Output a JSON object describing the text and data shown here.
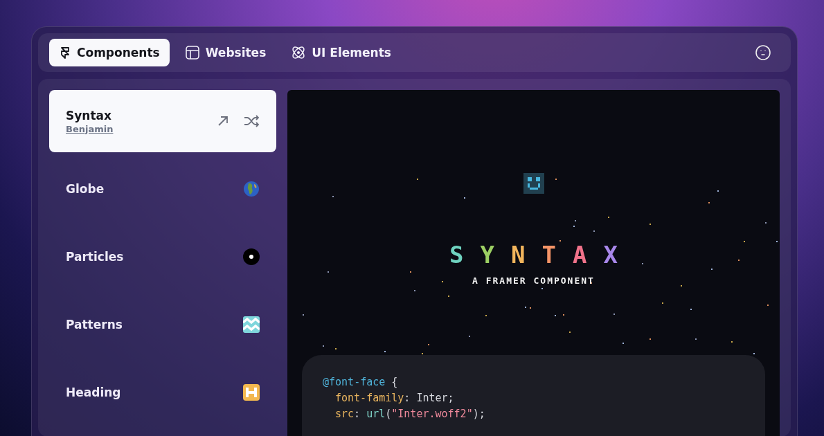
{
  "tabs": [
    {
      "label": "Components",
      "kind": "framer",
      "selected": true
    },
    {
      "label": "Websites",
      "kind": "layout",
      "selected": false
    },
    {
      "label": "UI Elements",
      "kind": "atom",
      "selected": false
    }
  ],
  "sidebar": {
    "items": [
      {
        "title": "Syntax",
        "author": "Benjamin",
        "kind": "actions",
        "selected": true
      },
      {
        "title": "Globe",
        "kind": "globe",
        "selected": false
      },
      {
        "title": "Particles",
        "kind": "particles",
        "selected": false
      },
      {
        "title": "Patterns",
        "kind": "patterns",
        "selected": false
      },
      {
        "title": "Heading",
        "kind": "heading",
        "selected": false
      }
    ]
  },
  "preview": {
    "title_letters": [
      {
        "text": "S",
        "color": "#6fd3c0"
      },
      {
        "text": "Y",
        "color": "#9ccf63"
      },
      {
        "text": "N",
        "color": "#f2b55c"
      },
      {
        "text": "T",
        "color": "#f59467"
      },
      {
        "text": "A",
        "color": "#f0728a"
      },
      {
        "text": "X",
        "color": "#a887ea"
      }
    ],
    "subtitle": "A FRAMER COMPONENT",
    "code": [
      {
        "kind": "rule",
        "tokens": [
          {
            "kind": "at",
            "text": "@font-face"
          },
          {
            "kind": "plain",
            "text": " {"
          }
        ]
      },
      {
        "kind": "declaration",
        "tokens": [
          {
            "kind": "prop",
            "text": "font-family"
          },
          {
            "kind": "plain",
            "text": ": Inter;"
          }
        ]
      },
      {
        "kind": "declaration",
        "tokens": [
          {
            "kind": "prop",
            "text": "src"
          },
          {
            "kind": "plain",
            "text": ": "
          },
          {
            "kind": "fn",
            "text": "url"
          },
          {
            "kind": "plain",
            "text": "("
          },
          {
            "kind": "str",
            "text": "\"Inter.woff2\""
          },
          {
            "kind": "plain",
            "text": ");"
          }
        ]
      }
    ]
  }
}
